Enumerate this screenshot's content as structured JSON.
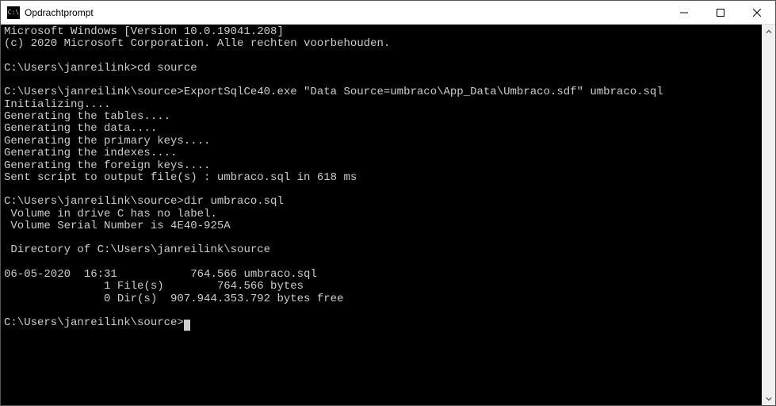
{
  "window": {
    "title": "Opdrachtprompt",
    "icon_text": "C:\\"
  },
  "terminal": {
    "lines": [
      "Microsoft Windows [Version 10.0.19041.208]",
      "(c) 2020 Microsoft Corporation. Alle rechten voorbehouden.",
      "",
      "C:\\Users\\janreilink>cd source",
      "",
      "C:\\Users\\janreilink\\source>ExportSqlCe40.exe \"Data Source=umbraco\\App_Data\\Umbraco.sdf\" umbraco.sql",
      "Initializing....",
      "Generating the tables....",
      "Generating the data....",
      "Generating the primary keys....",
      "Generating the indexes....",
      "Generating the foreign keys....",
      "Sent script to output file(s) : umbraco.sql in 618 ms",
      "",
      "C:\\Users\\janreilink\\source>dir umbraco.sql",
      " Volume in drive C has no label.",
      " Volume Serial Number is 4E40-925A",
      "",
      " Directory of C:\\Users\\janreilink\\source",
      "",
      "06-05-2020  16:31           764.566 umbraco.sql",
      "               1 File(s)        764.566 bytes",
      "               0 Dir(s)  907.944.353.792 bytes free",
      "",
      "C:\\Users\\janreilink\\source>"
    ]
  }
}
